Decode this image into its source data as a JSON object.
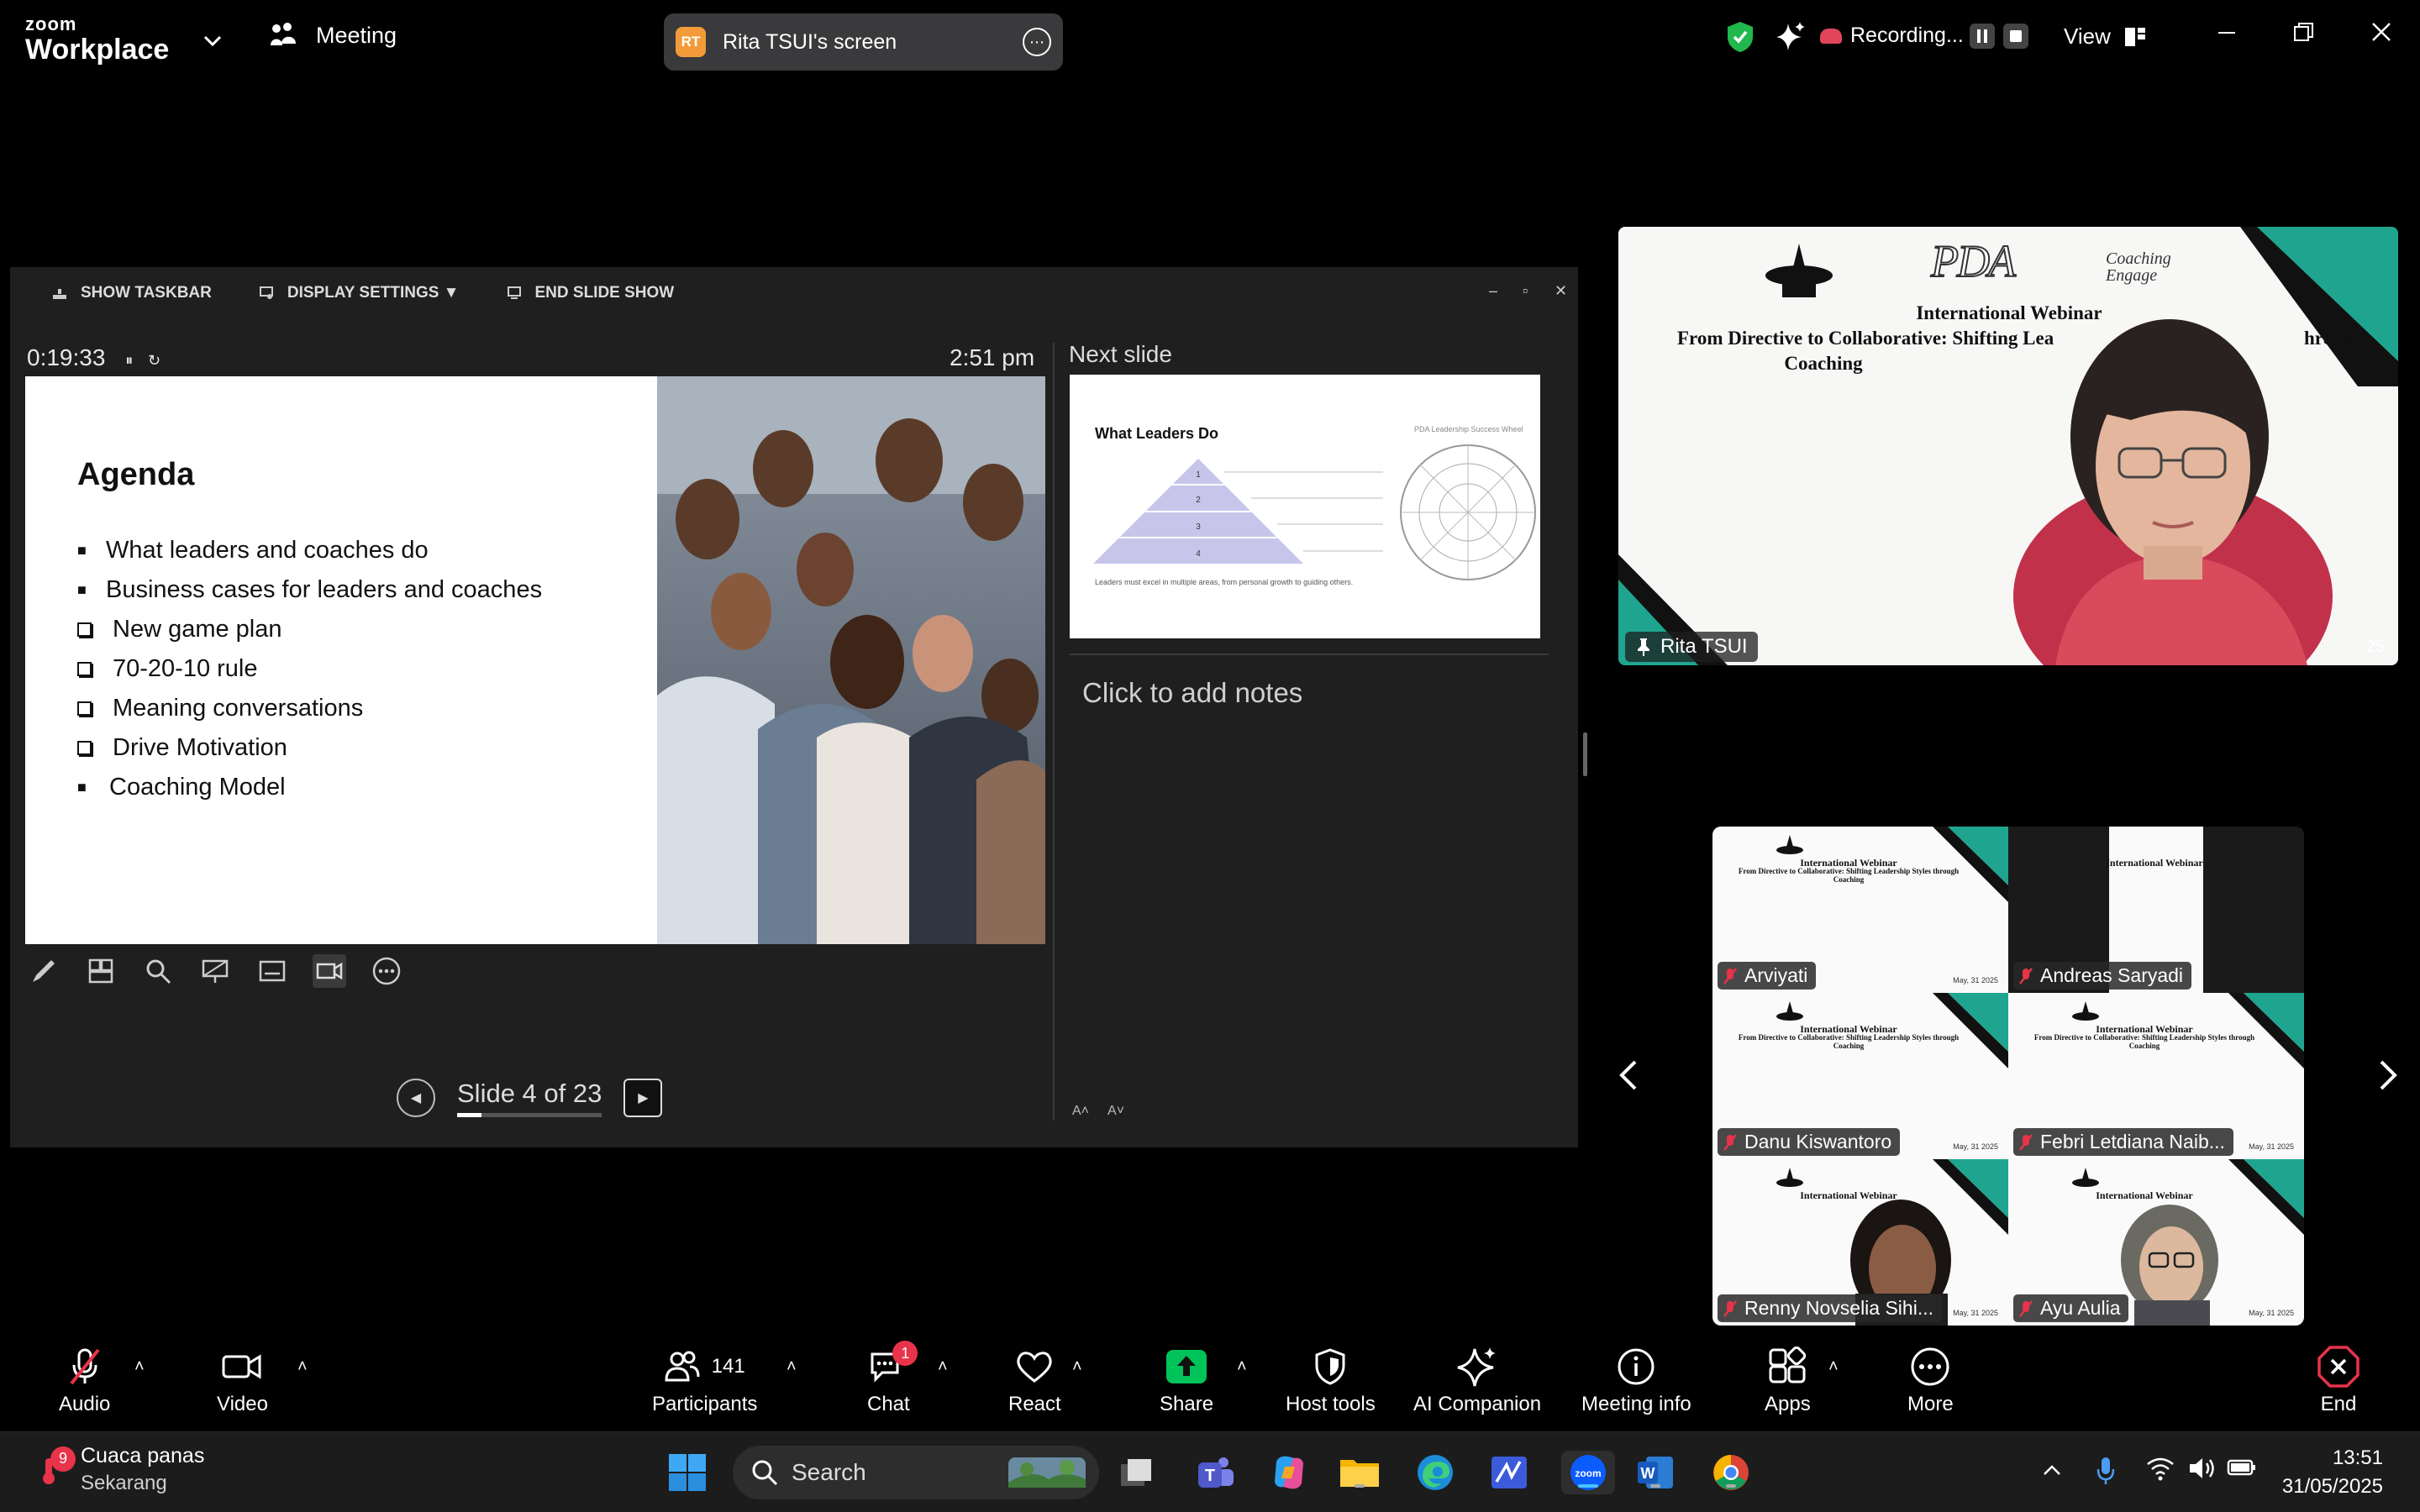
{
  "app": {
    "logo_small": "zoom",
    "logo_big": "Workplace"
  },
  "topbar": {
    "meeting_label": "Meeting",
    "share_initials": "RT",
    "share_title": "Rita TSUI's screen",
    "recording_label": "Recording...",
    "view_label": "View"
  },
  "presenter": {
    "toolbar": {
      "show_taskbar": "SHOW TASKBAR",
      "display_settings": "DISPLAY SETTINGS ▼",
      "end_show": "END SLIDE SHOW"
    },
    "elapsed": "0:19:33",
    "clock": "2:51 pm",
    "slide": {
      "title": "Agenda",
      "bullets": [
        "What leaders and coaches do",
        "Business cases for leaders and coaches",
        "New game plan",
        "70-20-10 rule",
        "Meaning conversations",
        "Drive Motivation",
        "Coaching Model"
      ]
    },
    "next_label": "Next slide",
    "next_slide": {
      "title": "What Leaders Do",
      "levels": [
        "1",
        "2",
        "3",
        "4"
      ],
      "caption": "Leaders must excel in multiple areas, from personal growth to guiding others.",
      "header": "PDA Leadership Success Wheel"
    },
    "notes_placeholder": "Click to add notes",
    "slide_counter": "Slide 4 of 23",
    "progress_fraction": 0.17
  },
  "speaker": {
    "webinar_line1": "International Webinar",
    "webinar_line2": "From Directive to Collaborative: Shifting Lea",
    "webinar_line2b": "hrough",
    "webinar_line3": "Coaching",
    "logo_text": "PDA",
    "coaching_logo": "Coaching Engage",
    "name": "Rita TSUI",
    "corner_text": "25"
  },
  "gallery": {
    "tile_title1": "International Webinar",
    "tile_title2": "From Directive to Collaborative: Shifting Leadership Styles through",
    "tile_title3": "Coaching",
    "tile_date": "May, 31 2025",
    "participants": [
      "Arviyati",
      "Andreas Saryadi",
      "Danu Kiswantoro",
      "Febri Letdiana Naib...",
      "Renny Novselia Sihi...",
      "Ayu Aulia"
    ]
  },
  "toolbar": {
    "audio": "Audio",
    "video": "Video",
    "participants": "Participants",
    "participants_count": "141",
    "chat": "Chat",
    "chat_badge": "1",
    "react": "React",
    "share": "Share",
    "host_tools": "Host tools",
    "ai_companion": "AI Companion",
    "meeting_info": "Meeting info",
    "apps": "Apps",
    "more": "More",
    "end": "End"
  },
  "taskbar": {
    "weather_badge": "9",
    "weather_title": "Cuaca panas",
    "weather_sub": "Sekarang",
    "search_placeholder": "Search",
    "time": "13:51",
    "date": "31/05/2025"
  },
  "colors": {
    "accent_teal": "#1fa58f",
    "recording_red": "#e0455a",
    "share_green": "#00c35a",
    "end_red": "#e8334a"
  }
}
